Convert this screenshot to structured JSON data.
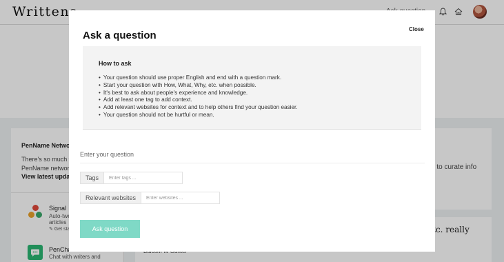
{
  "header": {
    "logo": "Writtens.",
    "links": "Ask question",
    "icons": [
      "bell-icon",
      "home-icon"
    ]
  },
  "sidebar": {
    "network_title": "PenName Network",
    "network_desc_1": "There's so much yo",
    "network_desc_2": "PenName network.",
    "network_link": "View latest update",
    "apps": [
      {
        "name": "Signal",
        "desc_1": "Auto-twe",
        "desc_2": "articles",
        "action": "✎ Get sta"
      },
      {
        "name": "PenCha",
        "desc_1": "Chat with writers and"
      }
    ]
  },
  "main": {
    "right_snippet": "es to curate info",
    "serif_snippet": "etc. really",
    "author_name": "Balcom W Gunter"
  },
  "modal": {
    "title": "Ask a question",
    "close_label": "Close",
    "howto_title": "How to ask",
    "howto_items": [
      "Your question should use proper English and end with a question mark.",
      "Start your question with How, What, Why, etc. when possible.",
      "It's best to ask about people's experience and knowledge.",
      "Add at least one tag to add context.",
      "Add relevant websites for context and to help others find your question easier.",
      "Your question should not be hurtful or mean."
    ],
    "question_placeholder": "Enter your question",
    "tags_label": "Tags",
    "tags_placeholder": "Enter tags ...",
    "websites_label": "Relevant websites",
    "websites_placeholder": "Enter websites ...",
    "ask_button": "Ask question",
    "ask_button_color": "#7fd9c6"
  }
}
